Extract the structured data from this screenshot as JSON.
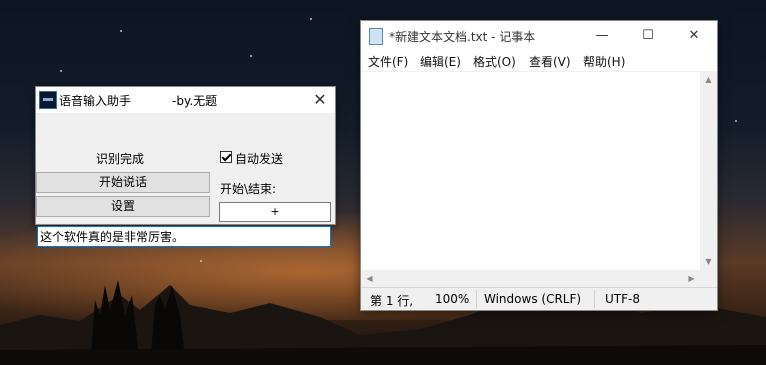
{
  "voice_window": {
    "title": "语音输入助手",
    "author": "-by.无题",
    "close_glyph": "✕",
    "status_label": "识别完成",
    "start_button": "开始说话",
    "settings_button": "设置",
    "auto_send_label": "自动发送",
    "auto_send_checked": true,
    "hotkey_label": "开始\\结束:",
    "hotkey_value": "+",
    "result_text": "这个软件真的是非常厉害。"
  },
  "notepad": {
    "title": "*新建文本文档.txt - 记事本",
    "controls": {
      "minimize": "—",
      "maximize": "☐",
      "close": "✕"
    },
    "menu": [
      "文件(F)",
      "编辑(E)",
      "格式(O)",
      "查看(V)",
      "帮助(H)"
    ],
    "status": {
      "position": "第 1 行, ",
      "zoom": "100%",
      "line_ending": "Windows (CRLF)",
      "encoding": "UTF-8"
    }
  }
}
